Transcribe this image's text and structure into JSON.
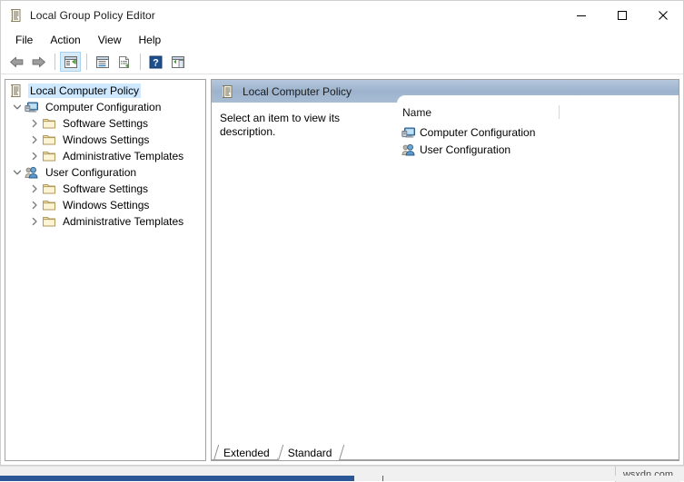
{
  "window": {
    "title": "Local Group Policy Editor",
    "title_icon": "policy-scroll-icon",
    "controls": {
      "minimize": "minimize-icon",
      "maximize": "maximize-icon",
      "close": "close-icon"
    }
  },
  "menubar": {
    "items": [
      {
        "label": "File"
      },
      {
        "label": "Action"
      },
      {
        "label": "View"
      },
      {
        "label": "Help"
      }
    ]
  },
  "toolbar": {
    "buttons": [
      {
        "icon": "back-arrow-icon",
        "label": "Back"
      },
      {
        "icon": "forward-arrow-icon",
        "label": "Forward"
      },
      {
        "icon": "show-hide-tree-icon",
        "label": "Show/Hide Console Tree"
      },
      {
        "icon": "properties-icon",
        "label": "Properties"
      },
      {
        "icon": "export-list-icon",
        "label": "Export List"
      },
      {
        "icon": "help-icon",
        "label": "Help"
      },
      {
        "icon": "show-hide-action-pane-icon",
        "label": "Show/Hide Action Pane"
      }
    ]
  },
  "tree": {
    "items": [
      {
        "label": "Local Computer Policy",
        "icon": "policy-scroll-icon",
        "indent": 0,
        "expander": "none",
        "selected": true
      },
      {
        "label": "Computer Configuration",
        "icon": "computer-icon",
        "indent": 1,
        "expander": "expanded",
        "selected": false
      },
      {
        "label": "Software Settings",
        "icon": "folder-icon",
        "indent": 2,
        "expander": "collapsed",
        "selected": false
      },
      {
        "label": "Windows Settings",
        "icon": "folder-icon",
        "indent": 2,
        "expander": "collapsed",
        "selected": false
      },
      {
        "label": "Administrative Templates",
        "icon": "folder-icon",
        "indent": 2,
        "expander": "collapsed",
        "selected": false
      },
      {
        "label": "User Configuration",
        "icon": "user-icon",
        "indent": 1,
        "expander": "expanded",
        "selected": false
      },
      {
        "label": "Software Settings",
        "icon": "folder-icon",
        "indent": 2,
        "expander": "collapsed",
        "selected": false
      },
      {
        "label": "Windows Settings",
        "icon": "folder-icon",
        "indent": 2,
        "expander": "collapsed",
        "selected": false
      },
      {
        "label": "Administrative Templates",
        "icon": "folder-icon",
        "indent": 2,
        "expander": "collapsed",
        "selected": false
      }
    ]
  },
  "right_pane": {
    "header": {
      "title": "Local Computer Policy",
      "icon": "policy-scroll-icon"
    },
    "description": "Select an item to view its description.",
    "list": {
      "columns": [
        "Name"
      ],
      "rows": [
        {
          "name": "Computer Configuration",
          "icon": "computer-icon"
        },
        {
          "name": "User Configuration",
          "icon": "user-icon"
        }
      ]
    },
    "tabs": [
      {
        "label": "Extended",
        "active": false
      },
      {
        "label": "Standard",
        "active": true
      }
    ]
  },
  "statusbar": {
    "watermark": "wsxdn.com"
  },
  "colors": {
    "pane_header_blue": "#9db3cd",
    "selection_blue": "#cde8ff",
    "toolbar_active": "#d6eaf8",
    "folder_yellow": "#f5d98a",
    "taskbar_blue": "#2b5797"
  }
}
